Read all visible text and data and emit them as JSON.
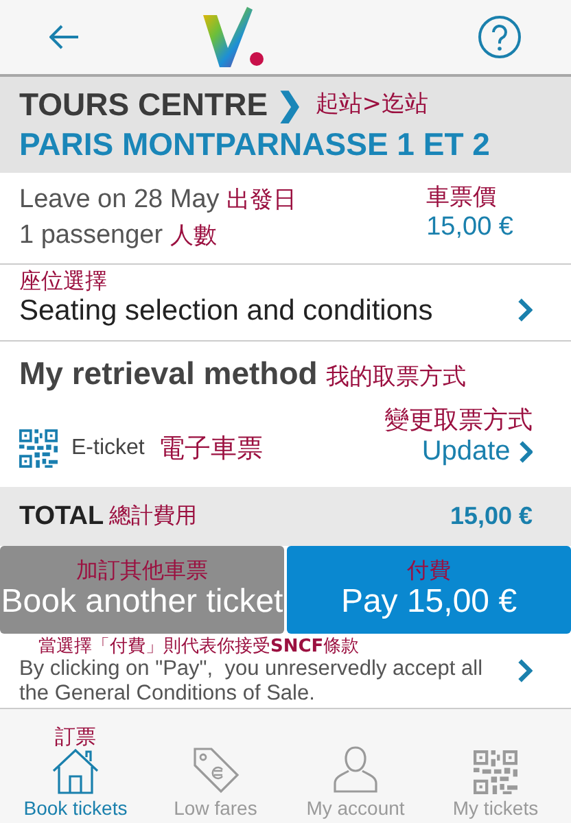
{
  "route": {
    "origin": "TOURS CENTRE",
    "separator": "❯",
    "destination": "PARIS MONTPARNASSE 1 ET 2",
    "note": "起站>迄站"
  },
  "trip": {
    "date": "Leave on 28 May",
    "date_note": "出發日",
    "passengers": "1 passenger",
    "passengers_note": "人數",
    "price_note": "車票價",
    "price": "15,00 €"
  },
  "seating": {
    "note": "座位選擇",
    "label": "Seating selection and conditions"
  },
  "retrieval": {
    "title": "My retrieval method",
    "title_note": "我的取票方式",
    "method": "E-ticket",
    "method_note": "電子車票",
    "update_note": "變更取票方式",
    "update": "Update"
  },
  "total": {
    "label": "TOTAL",
    "note": "總計費用",
    "amount": "15,00 €"
  },
  "buttons": [
    {
      "kind": "secondary",
      "note": "加訂其他車票",
      "label": "Book another ticket"
    },
    {
      "kind": "primary",
      "note": "付費",
      "label": "Pay 15,00 €"
    }
  ],
  "conditions": {
    "note": "當選擇「付費」則代表你接受**SNCF**條款",
    "text": "By clicking on \"Pay\",  you unreservedly accept all the General Conditions of Sale."
  },
  "tabs": [
    {
      "kind": "house",
      "label": "Book tickets",
      "selected": true,
      "note": "訂票"
    },
    {
      "kind": "tag",
      "label": "Low fares",
      "selected": false
    },
    {
      "kind": "person",
      "label": "My account",
      "selected": false
    },
    {
      "kind": "qr",
      "label": "My tickets",
      "selected": false
    }
  ]
}
